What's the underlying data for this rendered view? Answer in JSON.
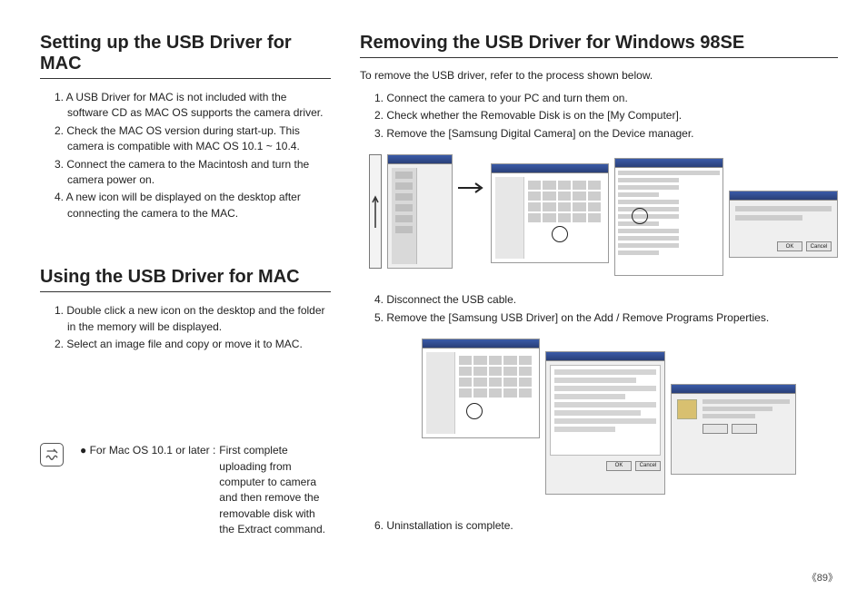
{
  "left": {
    "section1": {
      "title": "Setting up the USB Driver for MAC",
      "items": [
        "1. A USB Driver for MAC is not included with the software CD as MAC OS supports the camera driver.",
        "2. Check the MAC OS version during start-up. This camera is compatible with MAC OS 10.1 ~ 10.4.",
        "3. Connect the camera to the Macintosh and turn the camera power on.",
        "4. A new icon will be displayed on the desktop after connecting the camera to the MAC."
      ]
    },
    "section2": {
      "title": "Using the USB Driver for MAC",
      "items": [
        "1. Double click a new icon on the desktop and the folder in the memory will be displayed.",
        "2. Select an image file and copy or move it to MAC."
      ]
    },
    "note": {
      "label": "● For Mac OS 10.1 or later :",
      "body": "First complete uploading from computer to camera and then remove the removable disk with the Extract command."
    }
  },
  "right": {
    "title": "Removing the USB Driver for Windows 98SE",
    "intro": "To remove the USB driver, refer to the process shown below.",
    "list1": [
      "1. Connect the camera to your PC and turn them on.",
      "2. Check whether the Removable Disk is on the [My Computer].",
      "3. Remove the [Samsung Digital Camera] on the Device manager."
    ],
    "list2": [
      "4. Disconnect the USB cable.",
      "5. Remove the [Samsung USB Driver] on the Add / Remove Programs Properties."
    ],
    "list3": [
      "6. Uninstallation is complete."
    ],
    "buttons": {
      "ok": "OK",
      "cancel": "Cancel"
    }
  },
  "page_number": "《89》"
}
